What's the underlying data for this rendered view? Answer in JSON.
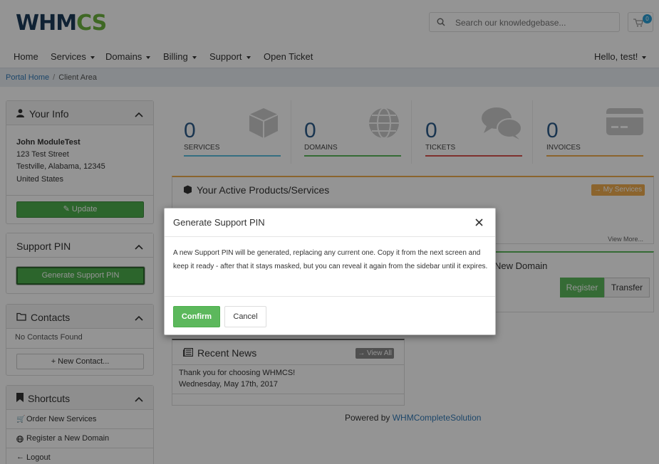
{
  "header": {
    "logo_main": "WHM",
    "logo_accent": "CS",
    "search_placeholder": "Search our knowledgebase...",
    "cart_count": "0"
  },
  "nav": {
    "items": [
      {
        "label": "Home",
        "dropdown": false
      },
      {
        "label": "Services",
        "dropdown": true
      },
      {
        "label": "Domains",
        "dropdown": true
      },
      {
        "label": "Billing",
        "dropdown": true
      },
      {
        "label": "Support",
        "dropdown": true
      },
      {
        "label": "Open Ticket",
        "dropdown": false
      }
    ],
    "user_greeting": "Hello, test!"
  },
  "breadcrumb": {
    "home": "Portal Home",
    "current": "Client Area"
  },
  "sidebar": {
    "your_info": {
      "title": "Your Info",
      "name": "John ModuleTest",
      "address1": "123 Test Street",
      "address2": "Testville, Alabama, 12345",
      "country": "United States",
      "update_label": "Update"
    },
    "support_pin": {
      "title": "Support PIN",
      "button_label": "Generate Support PIN"
    },
    "contacts": {
      "title": "Contacts",
      "empty_text": "No Contacts Found",
      "new_contact_label": "New Contact..."
    },
    "shortcuts": {
      "title": "Shortcuts",
      "items": [
        "Order New Services",
        "Register a New Domain",
        "Logout"
      ]
    }
  },
  "tiles": [
    {
      "count": "0",
      "label": "SERVICES",
      "color": "#5bc0de",
      "icon": "cube-icon"
    },
    {
      "count": "0",
      "label": "DOMAINS",
      "color": "#5cb85c",
      "icon": "globe-icon"
    },
    {
      "count": "0",
      "label": "TICKETS",
      "color": "#d9534f",
      "icon": "comments-icon"
    },
    {
      "count": "0",
      "label": "INVOICES",
      "color": "#f0ad4e",
      "icon": "credit-card-icon"
    }
  ],
  "products_panel": {
    "title": "Your Active Products/Services",
    "my_services_label": "My Services",
    "view_more_label": "View More..."
  },
  "domain_panel": {
    "title_suffix": "New Domain",
    "register_label": "Register",
    "transfer_label": "Transfer"
  },
  "news_panel": {
    "title": "Recent News",
    "view_all_label": "View All",
    "item_title": "Thank you for choosing WHMCS!",
    "item_date": "Wednesday, May 17th, 2017"
  },
  "footer": {
    "powered_by": "Powered by",
    "link": "WHMCompleteSolution"
  },
  "modal": {
    "title": "Generate Support PIN",
    "body": "A new Support PIN will be generated, replacing any current one. Copy it from the next screen and keep it ready - after that it stays masked, but you can reveal it again from the sidebar until it expires.",
    "confirm_label": "Confirm",
    "cancel_label": "Cancel"
  }
}
